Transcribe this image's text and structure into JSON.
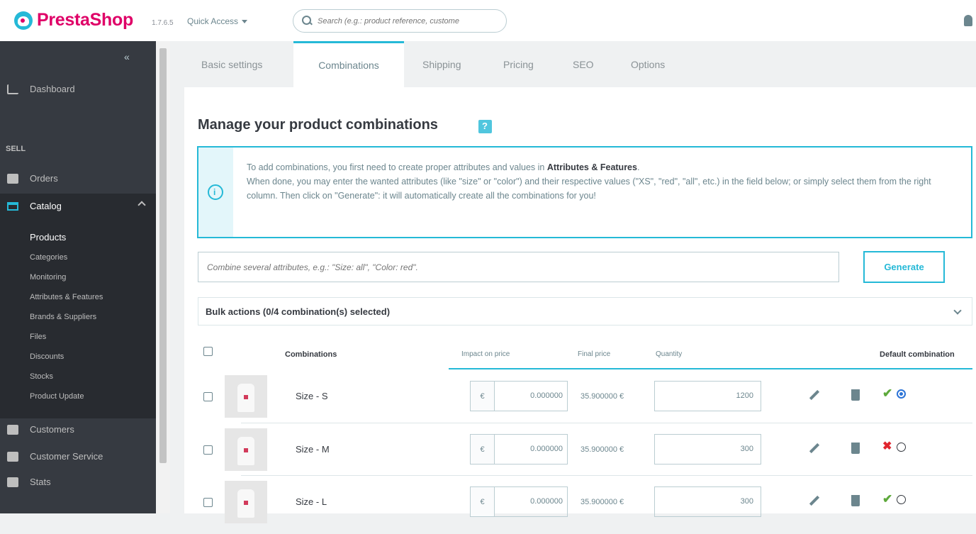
{
  "header": {
    "brand": "PrestaShop",
    "version": "1.7.6.5",
    "quick_access": "Quick Access",
    "search_placeholder": "Search (e.g.: product reference, custome"
  },
  "sidebar": {
    "dashboard": "Dashboard",
    "sell_section": "SELL",
    "orders": "Orders",
    "catalog": "Catalog",
    "catalog_items": [
      "Products",
      "Categories",
      "Monitoring",
      "Attributes & Features",
      "Brands & Suppliers",
      "Files",
      "Discounts",
      "Stocks",
      "Product Update"
    ],
    "customers": "Customers",
    "customer_service": "Customer Service",
    "stats": "Stats"
  },
  "tabs": [
    "Basic settings",
    "Combinations",
    "Shipping",
    "Pricing",
    "SEO",
    "Options"
  ],
  "active_tab": "Combinations",
  "page": {
    "title": "Manage your product combinations",
    "info_line1_prefix": "To add combinations, you first need to create proper attributes and values in ",
    "info_line1_link": "Attributes & Features",
    "info_line2": "When done, you may enter the wanted attributes (like \"size\" or \"color\") and their respective values (\"XS\", \"red\", \"all\", etc.) in the field below; or simply select them from the right column. Then click on \"Generate\": it will automatically create all the combinations for you!",
    "combine_placeholder": "Combine several attributes, e.g.: \"Size: all\", \"Color: red\".",
    "generate": "Generate",
    "bulk_actions": "Bulk actions (0/4 combination(s) selected)"
  },
  "table": {
    "headers": {
      "combinations": "Combinations",
      "impact": "Impact on price",
      "final": "Final price",
      "quantity": "Quantity",
      "default": "Default combination"
    },
    "rows": [
      {
        "name": "Size - S",
        "currency": "€",
        "impact": "0.000000",
        "final": "35.900000 €",
        "quantity": "1200",
        "status": "enabled",
        "default": true
      },
      {
        "name": "Size - M",
        "currency": "€",
        "impact": "0.000000",
        "final": "35.900000 €",
        "quantity": "300",
        "status": "disabled",
        "default": false
      },
      {
        "name": "Size - L",
        "currency": "€",
        "impact": "0.000000",
        "final": "35.900000 €",
        "quantity": "300",
        "status": "enabled",
        "default": false
      }
    ]
  },
  "colors": {
    "accent": "#25b9d7",
    "brand": "#df0067",
    "sidebar": "#363a41",
    "check": "#5da93b",
    "cross": "#e0252e"
  }
}
